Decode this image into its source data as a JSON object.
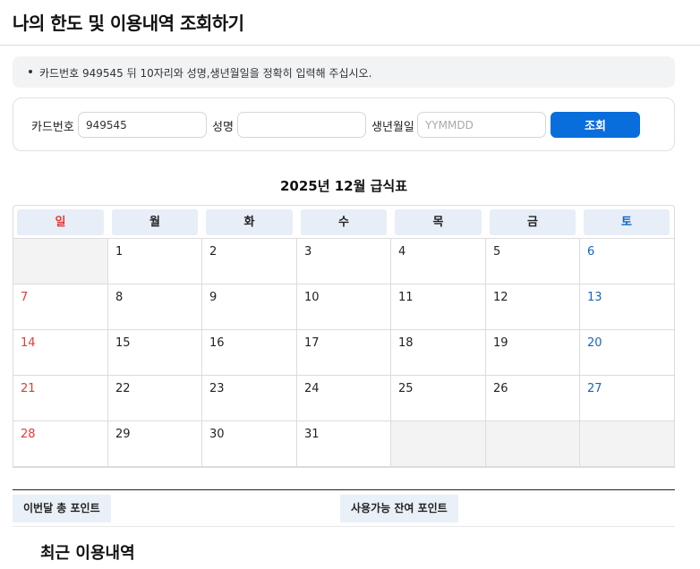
{
  "page": {
    "title": "나의 한도 및 이용내역 조회하기"
  },
  "notice": {
    "text": "카드번호 949545 뒤 10자리와 성명,생년월일을 정확히 입력해 주십시오."
  },
  "search": {
    "card_label": "카드번호",
    "card_value": "949545",
    "name_label": "성명",
    "name_value": "",
    "birth_label": "생년월일",
    "birth_placeholder": "YYMMDD",
    "submit_label": "조회"
  },
  "calendar": {
    "title": "2025년 12월 급식표",
    "weekdays": [
      "일",
      "월",
      "화",
      "수",
      "목",
      "금",
      "토"
    ],
    "weeks": [
      [
        "",
        "1",
        "2",
        "3",
        "4",
        "5",
        "6"
      ],
      [
        "7",
        "8",
        "9",
        "10",
        "11",
        "12",
        "13"
      ],
      [
        "14",
        "15",
        "16",
        "17",
        "18",
        "19",
        "20"
      ],
      [
        "21",
        "22",
        "23",
        "24",
        "25",
        "26",
        "27"
      ],
      [
        "28",
        "29",
        "30",
        "31",
        "",
        "",
        ""
      ]
    ],
    "colors": {
      "sunday": "#e53935",
      "saturday": "#1565c0",
      "weekday_header_bg": "#e8eef8",
      "empty_cell_bg": "#f3f3f3"
    }
  },
  "points": {
    "month_total_label": "이번달 총 포인트",
    "available_balance_label": "사용가능 잔여 포인트"
  },
  "recent": {
    "heading": "최근 이용내역"
  },
  "theme": {
    "accent": "#0a6ddc"
  }
}
